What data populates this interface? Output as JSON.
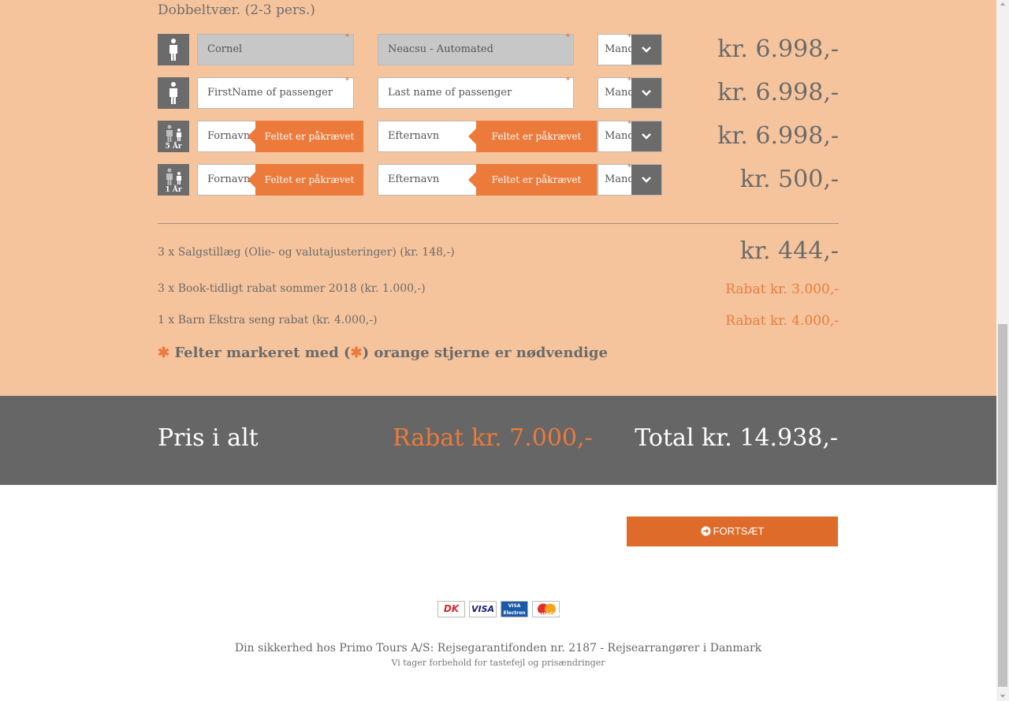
{
  "room": {
    "title": "Dobbeltvær. (2-3 pers.)"
  },
  "passengers": [
    {
      "type": "adult-icon",
      "first_name": "Cornel",
      "last_name": "Neacsu - Automated",
      "gender": "Mand",
      "price": "kr. 6.998,-"
    },
    {
      "type": "adult-icon",
      "first_name_placeholder": "FirstName of passenger",
      "last_name_placeholder": "Last name of passenger",
      "gender": "Mand",
      "price": "kr. 6.998,-"
    },
    {
      "type": "child-icon",
      "age": "5 År",
      "first_name_placeholder": "Fornavn",
      "last_name_placeholder": "Efternavn",
      "error": "Feltet er påkrævet",
      "gender": "Mand",
      "price": "kr. 6.998,-"
    },
    {
      "type": "child-icon",
      "age": "1 År",
      "first_name_placeholder": "Fornavn",
      "last_name_placeholder": "Efternavn",
      "error": "Feltet er påkrævet",
      "gender": "Mand",
      "price": "kr. 500,-"
    }
  ],
  "required_mark": "*",
  "fees": [
    {
      "label": "3 x Salgstillæg (Olie- og valutajusteringer) (kr. 148,-)",
      "value": "kr. 444,-"
    },
    {
      "label": "3 x Book-tidligt rabat sommer 2018 (kr. 1.000,-)",
      "value": "Rabat kr. 3.000,-"
    },
    {
      "label": "1 x Barn Ekstra seng rabat (kr. 4.000,-)",
      "value": "Rabat kr. 4.000,-"
    }
  ],
  "note": {
    "before": " Felter markeret med (",
    "after": ") orange stjerne er nødvendige"
  },
  "total": {
    "label": "Pris i alt",
    "discount": "Rabat kr. 7.000,-",
    "sum": "Total kr. 14.938,-"
  },
  "continue_button": {
    "label": "FORTSÆT"
  },
  "payment_cards": [
    "DK",
    "VISA",
    "VISA Electron",
    "MasterCard"
  ],
  "footer": {
    "line1": "Din sikkerhed hos Primo Tours A/S: Rejsegarantifonden nr. 2187 - Rejsearrangører i Danmark",
    "line2": "Vi tager forbehold for tastefejl og prisændringer"
  },
  "colors": {
    "peach": "#f6c49c",
    "accent": "#ec7a3b",
    "button": "#df6b2a",
    "bar": "#666666"
  }
}
